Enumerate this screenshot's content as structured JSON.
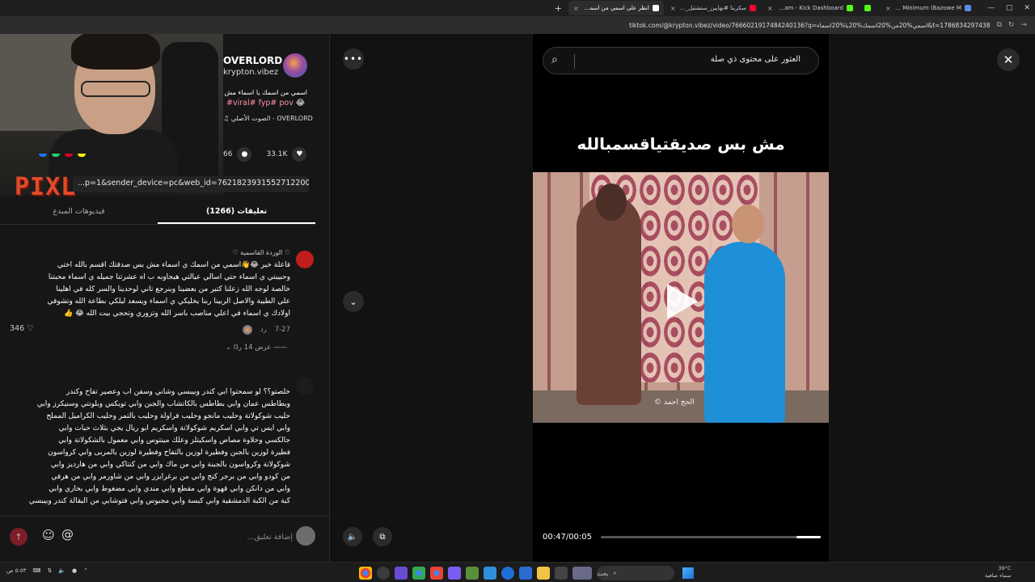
{
  "browser": {
    "tabs": [
      {
        "label": "Bazowy Minimum (Bazowe M...",
        "color": "#5a8cf0"
      },
      {
        "label": "",
        "color": "#53fc18"
      },
      {
        "label": "Stream - Kick Dashboard",
        "color": "#53fc18"
      },
      {
        "label": "سكربتا #نهايين_ستشتيل_الكريو...",
        "color": "#ff0033"
      },
      {
        "label": "انظر على اسمي من اسمك يا اسـ...",
        "color": "#ffffff"
      }
    ],
    "url": "tiktok.com/@krypton.vibez/video/7666021917484240136?q=اسمي%20من%20اسمك%20يا%20اسماء&t=1786834297438"
  },
  "creator": {
    "name": "OVERLORD",
    "handle": "krypton.vibez",
    "description": "اسمي من اسمك يا اسماء مش بس",
    "hashtags": "#viral# fyp# pov",
    "sound": "الصوت الأصلي - OVERLORD"
  },
  "stats": {
    "comments": "66",
    "likes": "33.1K"
  },
  "share_link": "...p=1&sender_device=pc&web_id=7621823931552712200",
  "tabs": {
    "comments": "تعليقات (1266)",
    "creator_videos": "فيديوهات المبدع"
  },
  "comments": [
    {
      "author": "♡ الوردة القاسمية ♡",
      "lines": [
        "فاعلة خير 😂👋اسمي من اسمك ي اسماء مش بس صدقتك اقسم بالله اختي",
        "وحبيبتي ي اسماء حتي اسالي عيالتي هيجاوبه ب اه عشرتنا جميله ي اسماء محبتنا",
        "خالصة لوجه الله زعلنا كتير من بعضينا وبنرجع تاني لوحدينا والسر كله في اهلينا",
        "علي الطيبة والاصل الربينا ربنا يخليكي ي اسماء ويسعد ليلكي بطاعة الله وتشوفي",
        "اولادك ي اسماء في اعلي مناصب باسر الله وتزوري وتحجي بيت الله 😂 👍"
      ],
      "date": "7-27",
      "reply": "رد",
      "likes": "346",
      "more_replies": "عرض 14 ردًا"
    },
    {
      "author": "",
      "lines": [
        "خلصتو؟؟ لو سمحتوا ابي كندر وبيبسي وشاني وسفن اب وعصير تفاح وكندر",
        "وبطاطس عمان وابي بطاطس بالكاتشاب والجبن وابي تويكس وبلونتي وسنيكرز وابي",
        "حليب شوكولاتة وحليب مانجو وحليب فراولة وحليب بالتمر وحليب الكراميل المملح",
        "وابي ايس تي وابي اسكريم شوكولاتة واسكريم ابو ريال يجي بثلاث حبات وابي",
        "جالكسي وحلاوة مصاص واسكيتلز وعلك مينتوس وابي معمول بالشكولاتة وابي",
        "فطيرة لوزين بالجبن وفطيرة لوزين بالتفاح وفطيرة لوزين بالمربى وابي كرواسون",
        "شوكولاتة وكرواسون بالجبنة وابي من ماك وابي من كنتاكي وابي من هارديز وابي",
        "من كودو وابي من برجر كنج وابي من برغرايزر وابي من شاورمر وابي من هرفي",
        "وابي من دانكن وابي قهوة وابي مقطع وابي مندي وابي مضغوط وابي بخاري وابي",
        "كبة من الكبة الدمشقية وابي كبسة وابي مجبوس وابي فتوشابي من البقالة كندر وبيبسي"
      ]
    }
  ],
  "comment_input": {
    "placeholder": "إضافة تعليق..."
  },
  "video": {
    "search_placeholder": "العثور على محتوى ذي صلة",
    "caption": "مش بس صديقتياقسمبالله",
    "watermark": "الحج احمد ©",
    "time": "00:47/00:05",
    "progress": 0.11
  },
  "taskbar": {
    "search": "بحث",
    "weather": "39°C",
    "weather_desc": "سماء صافية",
    "clock": "٥:٥٣ ص"
  }
}
